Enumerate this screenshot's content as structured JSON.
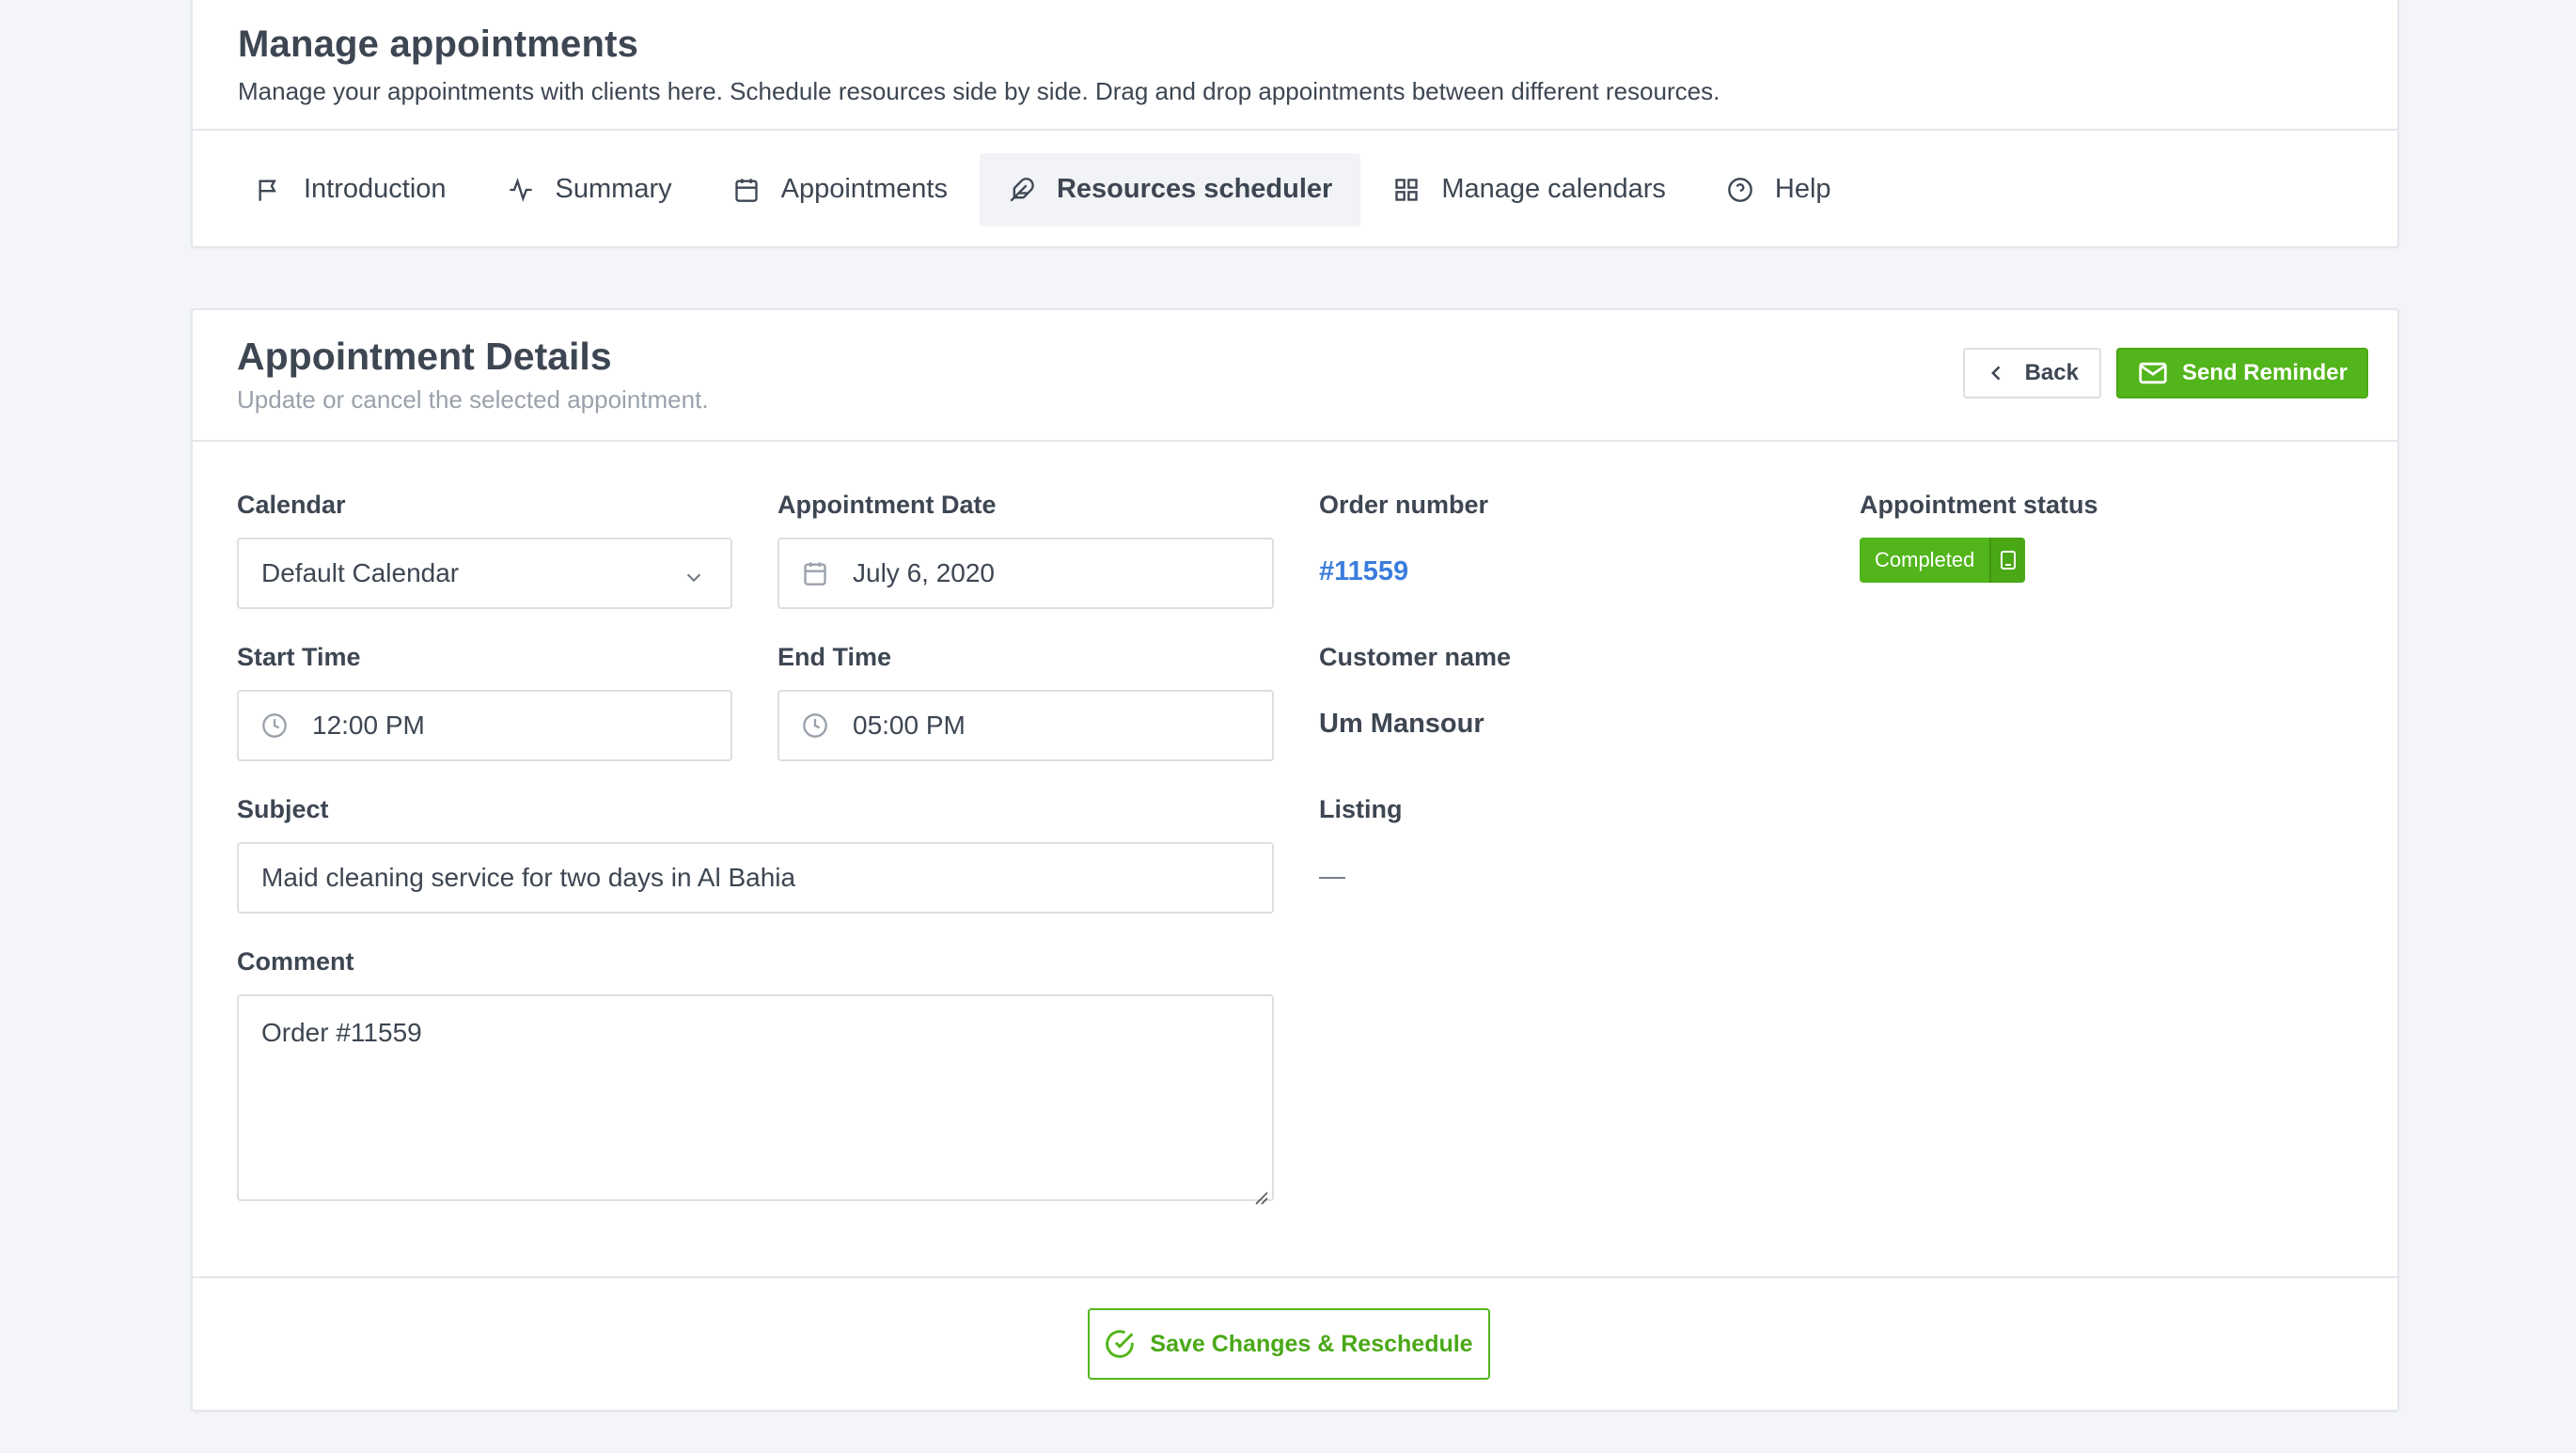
{
  "header": {
    "title": "Manage appointments",
    "subtitle": "Manage your appointments with clients here. Schedule resources side by side. Drag and drop appointments between different resources."
  },
  "tabs": [
    {
      "label": "Introduction",
      "icon": "flag-icon",
      "active": false
    },
    {
      "label": "Summary",
      "icon": "activity-icon",
      "active": false
    },
    {
      "label": "Appointments",
      "icon": "calendar-icon",
      "active": false
    },
    {
      "label": "Resources scheduler",
      "icon": "feather-icon",
      "active": true
    },
    {
      "label": "Manage calendars",
      "icon": "grid-icon",
      "active": false
    },
    {
      "label": "Help",
      "icon": "help-circle-icon",
      "active": false
    }
  ],
  "details": {
    "title": "Appointment Details",
    "subtitle": "Update or cancel the selected appointment.",
    "back_label": "Back",
    "send_reminder_label": "Send Reminder",
    "calendar": {
      "label": "Calendar",
      "value": "Default Calendar"
    },
    "appointment_date": {
      "label": "Appointment Date",
      "value": "July 6, 2020"
    },
    "start_time": {
      "label": "Start Time",
      "value": "12:00 PM"
    },
    "end_time": {
      "label": "End Time",
      "value": "05:00 PM"
    },
    "subject": {
      "label": "Subject",
      "value": "Maid cleaning service for two days in Al Bahia"
    },
    "comment": {
      "label": "Comment",
      "value": "Order #11559"
    },
    "order_number": {
      "label": "Order number",
      "value": "#11559"
    },
    "customer_name": {
      "label": "Customer name",
      "value": "Um Mansour"
    },
    "listing": {
      "label": "Listing",
      "value": "—"
    },
    "status": {
      "label": "Appointment status",
      "value": "Completed"
    },
    "save_label": "Save Changes & Reschedule"
  },
  "colors": {
    "accent_green": "#52b51b",
    "link_blue": "#3b7ddd",
    "page_bg": "#f4f5f8"
  }
}
